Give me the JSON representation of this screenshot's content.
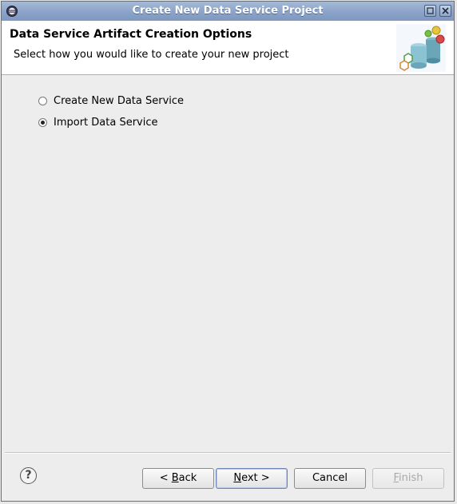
{
  "window": {
    "title": "Create New Data Service Project",
    "icon": "eclipse-icon"
  },
  "header": {
    "title": "Data Service Artifact Creation Options",
    "description": "Select how you would like to create your new project",
    "banner_icon": "data-service-wizard-banner-icon"
  },
  "options": [
    {
      "label": "Create New Data Service",
      "selected": false
    },
    {
      "label": "Import Data Service",
      "selected": true
    }
  ],
  "buttons": {
    "back_prefix": "< ",
    "back_mnemonic": "B",
    "back_rest": "ack",
    "next_mnemonic": "N",
    "next_rest": "ext >",
    "cancel": "Cancel",
    "finish_mnemonic": "F",
    "finish_rest": "inish"
  },
  "help_symbol": "?"
}
